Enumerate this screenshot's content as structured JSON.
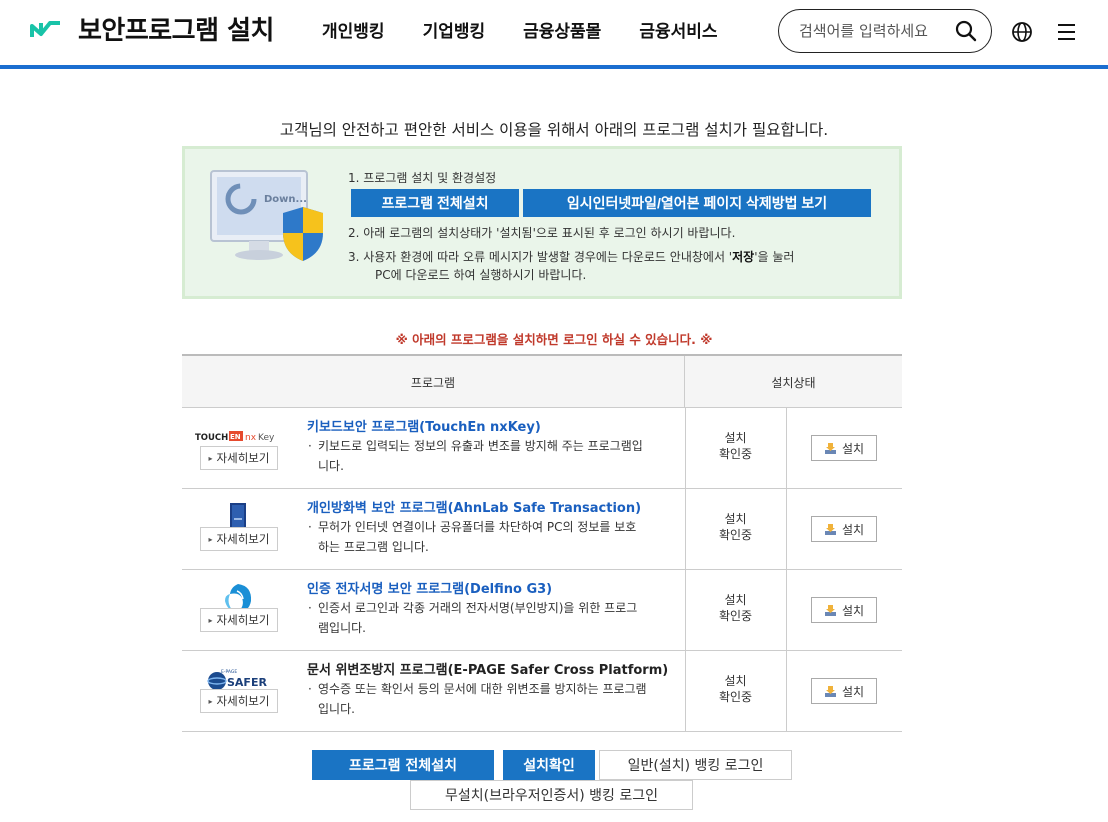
{
  "header": {
    "title": "보안프로그램 설치",
    "nav": [
      "개인뱅킹",
      "기업뱅킹",
      "금융상품몰",
      "금융서비스"
    ],
    "search_placeholder": "검색어를 입력하세요",
    "icons": [
      "logo-icon",
      "search-icon",
      "globe-icon",
      "hamburger-menu-icon"
    ],
    "accent_color": "#1a6ed0"
  },
  "notice": "고객님의 안전하고 편안한 서비스 이용을 위해서 아래의 프로그램 설치가 필요합니다.",
  "install_box": {
    "monitor_text": "Down...",
    "step1": "1. 프로그램 설치 및 환경설정",
    "btn_install_all": "프로그램 전체설치",
    "btn_delete_guide": "임시인터넷파일/열어본 페이지 삭제방법 보기",
    "step2": "2. 아래 로그램의 설치상태가 '설치됨'으로 표시된 후 로그인 하시기 바랍니다.",
    "step3_a": "3. 사용자 환경에 따라 오류 메시지가 발생할 경우에는 다운로드 안내창에서 '",
    "step3_bold": "저장",
    "step3_b": "'을 눌러",
    "step3_c": "PC에 다운로드 하여 실행하시기 바랍니다."
  },
  "warning": "※ 아래의 프로그램을 설치하면 로그인 하실 수 있습니다. ※",
  "table": {
    "headers": {
      "program": "프로그램",
      "status": "설치상태"
    },
    "rows": [
      {
        "logo": "TOUCHEN nxKey",
        "detail": "자세히보기",
        "name": "키보드보안 프로그램(TouchEn nxKey)",
        "desc1": "키보드로 입력되는 정보의 유출과 변조를 방지해 주는 프로그램입",
        "desc2": "니다.",
        "status1": "설치",
        "status2": "확인중",
        "install": "설치"
      },
      {
        "logo": "AhnLab box",
        "detail": "자세히보기",
        "name": "개인방화벽 보안 프로그램(AhnLab Safe Transaction)",
        "desc1": "무허가 인터넷 연결이나 공유폴더를 차단하여 PC의 정보를 보호",
        "desc2": "하는 프로그램 입니다.",
        "status1": "설치",
        "status2": "확인중",
        "install": "설치"
      },
      {
        "logo": "Delfino dolphin",
        "detail": "자세히보기",
        "name": "인증 전자서명 보안 프로그램(Delfino G3)",
        "desc1": "인증서 로그인과 각종 거래의 전자서명(부인방지)을 위한 프로그",
        "desc2": "램입니다.",
        "status1": "설치",
        "status2": "확인중",
        "install": "설치"
      },
      {
        "logo": "SAFER",
        "detail": "자세히보기",
        "name": "문서 위변조방지 프로그램(E-PAGE Safer Cross Platform)",
        "desc1": "영수증 또는 확인서 등의 문서에 대한 위변조를 방지하는 프로그램",
        "desc2": "입니다.",
        "status1": "설치",
        "status2": "확인중",
        "install": "설치"
      }
    ]
  },
  "bottom": {
    "install_all": "프로그램 전체설치",
    "check": "설치확인",
    "general_login": "일반(설치) 뱅킹 로그인",
    "noinstall_login": "무설치(브라우저인증서) 뱅킹 로그인"
  }
}
